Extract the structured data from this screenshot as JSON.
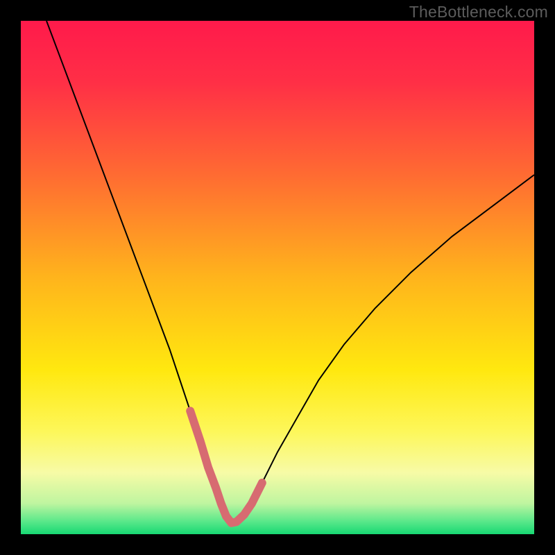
{
  "watermark": "TheBottleneck.com",
  "chart_data": {
    "type": "line",
    "title": "",
    "xlabel": "",
    "ylabel": "",
    "xlim": [
      0,
      100
    ],
    "ylim": [
      0,
      100
    ],
    "gradient_stops": [
      {
        "offset": 0.0,
        "color": "#ff1a4b"
      },
      {
        "offset": 0.12,
        "color": "#ff2f46"
      },
      {
        "offset": 0.3,
        "color": "#ff6b32"
      },
      {
        "offset": 0.5,
        "color": "#ffb41c"
      },
      {
        "offset": 0.68,
        "color": "#ffe80f"
      },
      {
        "offset": 0.8,
        "color": "#fdf75a"
      },
      {
        "offset": 0.88,
        "color": "#f7fba6"
      },
      {
        "offset": 0.94,
        "color": "#bff5a0"
      },
      {
        "offset": 0.975,
        "color": "#5ae88a"
      },
      {
        "offset": 1.0,
        "color": "#17d873"
      }
    ],
    "series": [
      {
        "name": "bottleneck-curve",
        "stroke": "#000000",
        "stroke_width": 2,
        "x": [
          5,
          8,
          11,
          14,
          17,
          20,
          23,
          26,
          29,
          31,
          33,
          35,
          36.5,
          38,
          39,
          40,
          41,
          42,
          43.5,
          45,
          47,
          50,
          54,
          58,
          63,
          69,
          76,
          84,
          92,
          100
        ],
        "y": [
          100,
          92,
          84,
          76,
          68,
          60,
          52,
          44,
          36,
          30,
          24,
          18,
          13,
          9,
          6,
          3.5,
          2.2,
          2.4,
          3.8,
          6,
          10,
          16,
          23,
          30,
          37,
          44,
          51,
          58,
          64,
          70
        ]
      },
      {
        "name": "optimal-zone-overlay",
        "stroke": "#d76b71",
        "stroke_width": 12,
        "linecap": "round",
        "x": [
          33,
          35,
          36.5,
          38,
          39,
          40,
          41,
          42,
          43.5,
          45,
          47
        ],
        "y": [
          24,
          18,
          13,
          9,
          6,
          3.5,
          2.2,
          2.4,
          3.8,
          6,
          10
        ]
      }
    ]
  }
}
